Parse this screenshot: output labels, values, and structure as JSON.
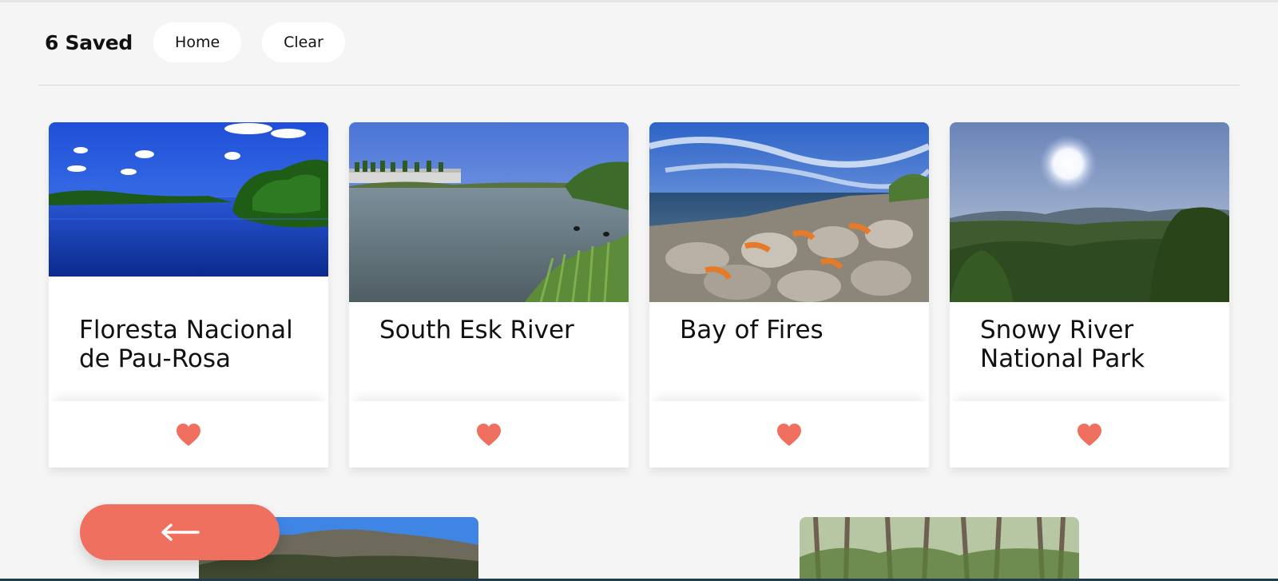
{
  "header": {
    "saved_label": "6 Saved",
    "home_label": "Home",
    "clear_label": "Clear"
  },
  "cards": [
    {
      "title": "Floresta Nacional de Pau-Rosa",
      "favorited": true,
      "icon": "heart-icon"
    },
    {
      "title": "South Esk River",
      "favorited": true,
      "icon": "heart-icon"
    },
    {
      "title": "Bay of Fires",
      "favorited": true,
      "icon": "heart-icon"
    },
    {
      "title": "Snowy River National Park",
      "favorited": true,
      "icon": "heart-icon"
    }
  ],
  "back_button": {
    "icon": "arrow-left-icon"
  },
  "colors": {
    "accent": "#f07060",
    "background": "#f5f5f5",
    "card": "#ffffff"
  }
}
